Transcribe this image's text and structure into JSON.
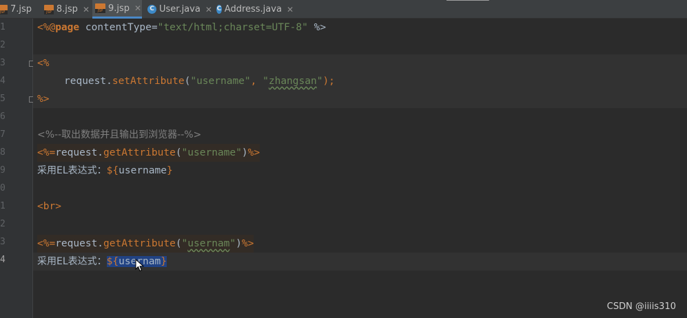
{
  "tabs": [
    {
      "label": "7.jsp",
      "type": "jsp",
      "active": false,
      "closable": false
    },
    {
      "label": "8.jsp",
      "type": "jsp",
      "active": false,
      "closable": true
    },
    {
      "label": "9.jsp",
      "type": "jsp",
      "active": true,
      "closable": true
    },
    {
      "label": "User.java",
      "type": "class",
      "active": false,
      "closable": true
    },
    {
      "label": "Address.java",
      "type": "class",
      "active": false,
      "closable": true
    }
  ],
  "tab_icons": {
    "jsp_text": "JSP",
    "class_text": "C",
    "close_glyph": "✕"
  },
  "line_numbers": [
    "1",
    "2",
    "3",
    "4",
    "5",
    "6",
    "7",
    "8",
    "9",
    "0",
    "1",
    "2",
    "3",
    "4"
  ],
  "code": {
    "l1": {
      "open": "<%@",
      "dir": "page",
      "attr": " contentType=",
      "val": "\"text/html;charset=UTF-8\"",
      "close": " %>"
    },
    "l3": {
      "open": "<%"
    },
    "l4": {
      "obj": "request.",
      "method": "setAttribute",
      "p1": "(",
      "s1": "\"username\"",
      "comma": ", ",
      "q1": "\"",
      "typo": "zhangsan",
      "q2": "\"",
      "end": ");"
    },
    "l5": {
      "close": "%>"
    },
    "l7": {
      "comment": "<%--取出数据并且输出到浏览器--%>"
    },
    "l8": {
      "open": "<%=",
      "obj": "request.",
      "method": "getAttribute",
      "p1": "(",
      "s1": "\"username\"",
      "p2": ")",
      "close": "%>"
    },
    "l9": {
      "label": "采用EL表达式：",
      "el_open": "${",
      "var": "username",
      "el_close": "}"
    },
    "l11": {
      "tag": "<br>"
    },
    "l13": {
      "open": "<%=",
      "obj": "request.",
      "method": "getAttribute",
      "p1": "(",
      "q1": "\"",
      "typo": "usernam",
      "q2": "\"",
      "p2": ")",
      "close": "%>"
    },
    "l14": {
      "label": "采用EL表达式：",
      "el_open": "${",
      "var": "usernam",
      "el_close": "}"
    }
  },
  "watermark": "CSDN @iiiis310",
  "colors": {
    "keyword": "#cc7832",
    "string": "#6a8759",
    "text": "#a9b7c6",
    "comment": "#808080",
    "selection": "#214283",
    "active_tab_underline": "#4a88c7"
  },
  "icons": {
    "jsp_file": "jsp-file-icon",
    "java_class": "java-class-icon",
    "mouse": "mouse-pointer-icon"
  }
}
